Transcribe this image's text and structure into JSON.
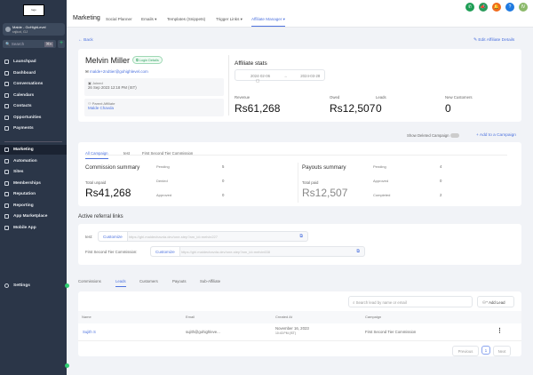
{
  "sidebar": {
    "logo_text": "logo",
    "account_name": "Malde - GoHighLevel",
    "account_location": "rajkot, GJ",
    "search_placeholder": "Search",
    "search_shortcut": "⌘K",
    "items": [
      {
        "label": "Launchpad"
      },
      {
        "label": "Dashboard"
      },
      {
        "label": "Conversations"
      },
      {
        "label": "Calendars"
      },
      {
        "label": "Contacts"
      },
      {
        "label": "Opportunities"
      },
      {
        "label": "Payments"
      }
    ],
    "items2": [
      {
        "label": "Marketing",
        "active": true
      },
      {
        "label": "Automation"
      },
      {
        "label": "Sites"
      },
      {
        "label": "Memberships"
      },
      {
        "label": "Reputation"
      },
      {
        "label": "Reporting"
      },
      {
        "label": "App Marketplace"
      },
      {
        "label": "Mobile App"
      }
    ],
    "settings": "Settings"
  },
  "header": {
    "title": "Marketing",
    "tabs": [
      "Social Planner",
      "Emails",
      "Templates (Snippets)",
      "Trigger Links",
      "Affiliate Manager"
    ],
    "active_tab": "Affiliate Manager",
    "avatar": "IV"
  },
  "back": "Back",
  "edit": "Edit Affiliate Details",
  "affiliate": {
    "name": "Melvin Miller",
    "login_badge": "Login Details",
    "email": "malde+2ndtier@gohighlevel.com",
    "joined_label": "Joined",
    "joined": "26 Sep 2023 12:18 PM (IST)",
    "parent_label": "Parent Affiliate",
    "parent": "Malde Chavda"
  },
  "stats": {
    "title": "Affiliate stats",
    "date_from": "2024-02-06",
    "date_to": "2024-03-28",
    "items": [
      {
        "label": "Revenue",
        "value": "Rs61,268"
      },
      {
        "label": "Owed",
        "value": "Rs12,507"
      },
      {
        "label": "Leads",
        "value": "0"
      },
      {
        "label": "New Customers",
        "value": "0"
      }
    ]
  },
  "campaign_controls": {
    "show_deleted": "Show Deleted Campaign",
    "show_deleted_on": false,
    "add": "Add to a Campaign"
  },
  "campaign_tabs": [
    "All Campaign",
    "test",
    "First Second Tier Commission"
  ],
  "commission": {
    "title": "Commission summary",
    "total_label": "Total unpaid",
    "total": "Rs41,268",
    "rows": [
      {
        "label": "Pending",
        "value": "5"
      },
      {
        "label": "Denied",
        "value": "0"
      },
      {
        "label": "Approved",
        "value": "0"
      }
    ]
  },
  "payouts": {
    "title": "Payouts summary",
    "total_label": "Total paid",
    "total": "Rs12,507",
    "rows": [
      {
        "label": "Pending",
        "value": "4"
      },
      {
        "label": "Approved",
        "value": "0"
      },
      {
        "label": "Completed",
        "value": "2"
      }
    ]
  },
  "referral": {
    "title": "Active referral links",
    "customize": "Customize",
    "links": [
      {
        "label": "test:",
        "url": "https://ghl.maldechavda.dev/one-step?am_id=melvin227"
      },
      {
        "label": "First Second Tier Commission:",
        "url": "https://ghl.maldechavda.dev/one-step?am_id=melvin638"
      }
    ]
  },
  "bottom_tabs": [
    "Commissions",
    "Leads",
    "Customers",
    "Payouts",
    "Sub-Affiliate"
  ],
  "active_bottom_tab": "Leads",
  "leads": {
    "search_placeholder": "Search lead by name or email",
    "add": "Add Lead",
    "columns": [
      "Name",
      "Email",
      "Created At",
      "Campaign"
    ],
    "rows": [
      {
        "name": "Sujith S",
        "email": "sujith@gohighleve...",
        "date": "November 16, 2023",
        "time": "10:43 PM (IST)",
        "campaign": "First Second Tier Commission"
      }
    ],
    "prev": "Previous",
    "page": "1",
    "next": "Next"
  }
}
